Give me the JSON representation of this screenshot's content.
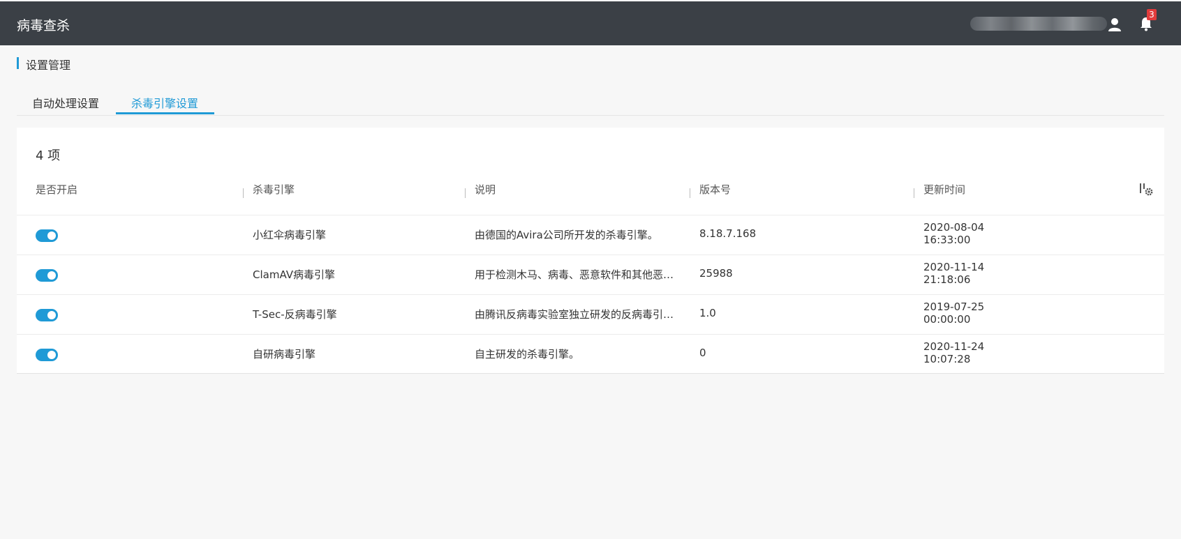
{
  "header": {
    "title": "病毒查杀",
    "notification_count": "3"
  },
  "section": {
    "title": "设置管理"
  },
  "tabs": [
    {
      "label": "自动处理设置",
      "active": false
    },
    {
      "label": "杀毒引擎设置",
      "active": true
    }
  ],
  "table": {
    "count_label": "4 项",
    "columns": [
      "是否开启",
      "杀毒引擎",
      "说明",
      "版本号",
      "更新时间"
    ],
    "rows": [
      {
        "enabled": true,
        "engine": "小红伞病毒引擎",
        "description": "由德国的Avira公司所开发的杀毒引擎。",
        "version": "8.18.7.168",
        "date": "2020-08-04",
        "time": "16:33:00"
      },
      {
        "enabled": true,
        "engine": "ClamAV病毒引擎",
        "description": "用于检测木马、病毒、恶意软件和其他恶意...",
        "version": "25988",
        "date": "2020-11-14",
        "time": "21:18:06"
      },
      {
        "enabled": true,
        "engine": "T-Sec-反病毒引擎",
        "description": "由腾讯反病毒实验室独立研发的反病毒引擎。",
        "version": "1.0",
        "date": "2019-07-25",
        "time": "00:00:00"
      },
      {
        "enabled": true,
        "engine": "自研病毒引擎",
        "description": "自主研发的杀毒引擎。",
        "version": "0",
        "date": "2020-11-24",
        "time": "10:07:28"
      }
    ]
  },
  "colors": {
    "topbar": "#3b4046",
    "accent": "#1f9ad6",
    "badge": "#e23b3b"
  },
  "icons": [
    "user-icon",
    "bell-icon",
    "column-settings-icon",
    "toggle-switch"
  ]
}
